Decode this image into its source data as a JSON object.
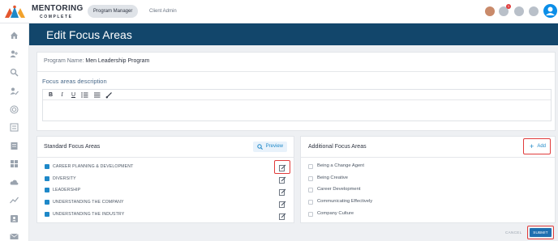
{
  "app": {
    "brand_name": "MENTORING",
    "brand_sub": "COMPLETE",
    "role_tabs": [
      {
        "label": "Program Manager",
        "active": true
      },
      {
        "label": "Client Admin",
        "active": false
      }
    ],
    "notification_count": "1"
  },
  "sidebar": {
    "icons": [
      "home-icon",
      "users-icon",
      "search-user-icon",
      "edit-user-icon",
      "target-icon",
      "list-icon",
      "book-icon",
      "groups-icon",
      "cloud-icon",
      "chart-icon",
      "id-card-icon",
      "mail-icon"
    ]
  },
  "page": {
    "title": "Edit Focus Areas",
    "program_label": "Program Name:",
    "program_value": "Men Leadership Program",
    "description_label": "Focus areas description",
    "editor_tools": [
      "B",
      "I",
      "U",
      "ordered-list-icon",
      "bullet-list-icon",
      "brush-icon"
    ]
  },
  "standard": {
    "title": "Standard Focus Areas",
    "preview_label": "Preview",
    "items": [
      {
        "label": "CAREER PLANNING & DEVELOPMENT",
        "checked": true
      },
      {
        "label": "DIVERSITY",
        "checked": true
      },
      {
        "label": "LEADERSHIP",
        "checked": true
      },
      {
        "label": "UNDERSTANDING THE COMPANY",
        "checked": true
      },
      {
        "label": "UNDERSTANDING THE INDUSTRY",
        "checked": true
      }
    ]
  },
  "additional": {
    "title": "Additional Focus Areas",
    "add_label": "Add",
    "items": [
      {
        "label": "Being a Change Agent",
        "checked": false
      },
      {
        "label": "Being Creative",
        "checked": false
      },
      {
        "label": "Career Development",
        "checked": false
      },
      {
        "label": "Communicating Effectively",
        "checked": false
      },
      {
        "label": "Company Culture",
        "checked": false
      }
    ]
  },
  "actions": {
    "cancel_label": "CANCEL",
    "submit_label": "SUBMIT"
  },
  "colors": {
    "header_band": "#12466b",
    "accent": "#1e88c8",
    "highlight": "#e03b3b"
  }
}
